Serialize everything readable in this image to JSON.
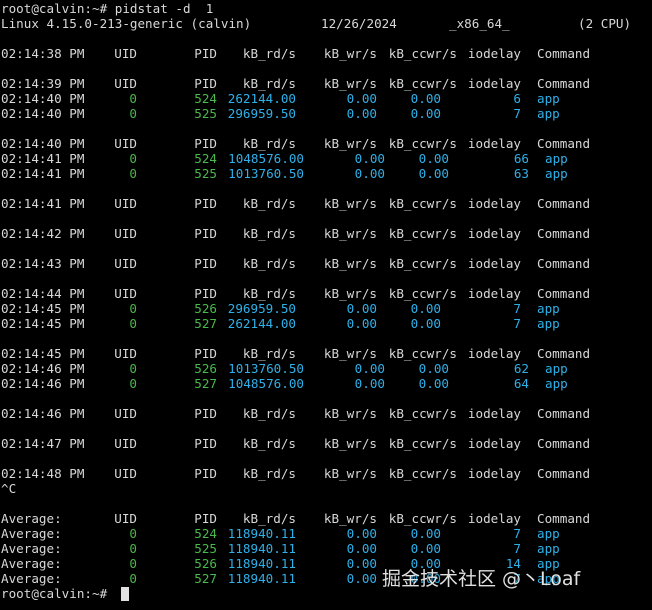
{
  "prompt_command": "root@calvin:~# pidstat -d  1",
  "sysinfo": {
    "kernel": "Linux 4.15.0-213-generic (calvin)",
    "date": "12/26/2024",
    "arch": "_x86_64_",
    "cpus": "(2 CPU)"
  },
  "lines": [
    {
      "kind": "header",
      "time": "02:14:38 PM"
    },
    {
      "kind": "blank"
    },
    {
      "kind": "header",
      "time": "02:14:39 PM"
    },
    {
      "kind": "row",
      "time": "02:14:40 PM",
      "uid": "0",
      "pid": "524",
      "rd": "262144.00",
      "wr": "0.00",
      "ccwr": "0.00",
      "iodelay": "6",
      "command": "app"
    },
    {
      "kind": "row",
      "time": "02:14:40 PM",
      "uid": "0",
      "pid": "525",
      "rd": "296959.50",
      "wr": "0.00",
      "ccwr": "0.00",
      "iodelay": "7",
      "command": "app"
    },
    {
      "kind": "blank"
    },
    {
      "kind": "header",
      "time": "02:14:40 PM"
    },
    {
      "kind": "row",
      "time": "02:14:41 PM",
      "uid": "0",
      "pid": "524",
      "rd": "1048576.00",
      "wr": "0.00",
      "ccwr": "0.00",
      "iodelay": "66",
      "command": "app"
    },
    {
      "kind": "row",
      "time": "02:14:41 PM",
      "uid": "0",
      "pid": "525",
      "rd": "1013760.50",
      "wr": "0.00",
      "ccwr": "0.00",
      "iodelay": "63",
      "command": "app"
    },
    {
      "kind": "blank"
    },
    {
      "kind": "header",
      "time": "02:14:41 PM"
    },
    {
      "kind": "blank"
    },
    {
      "kind": "header",
      "time": "02:14:42 PM"
    },
    {
      "kind": "blank"
    },
    {
      "kind": "header",
      "time": "02:14:43 PM"
    },
    {
      "kind": "blank"
    },
    {
      "kind": "header",
      "time": "02:14:44 PM"
    },
    {
      "kind": "row",
      "time": "02:14:45 PM",
      "uid": "0",
      "pid": "526",
      "rd": "296959.50",
      "wr": "0.00",
      "ccwr": "0.00",
      "iodelay": "7",
      "command": "app"
    },
    {
      "kind": "row",
      "time": "02:14:45 PM",
      "uid": "0",
      "pid": "527",
      "rd": "262144.00",
      "wr": "0.00",
      "ccwr": "0.00",
      "iodelay": "7",
      "command": "app"
    },
    {
      "kind": "blank"
    },
    {
      "kind": "header",
      "time": "02:14:45 PM"
    },
    {
      "kind": "row",
      "time": "02:14:46 PM",
      "uid": "0",
      "pid": "526",
      "rd": "1013760.50",
      "wr": "0.00",
      "ccwr": "0.00",
      "iodelay": "62",
      "command": "app"
    },
    {
      "kind": "row",
      "time": "02:14:46 PM",
      "uid": "0",
      "pid": "527",
      "rd": "1048576.00",
      "wr": "0.00",
      "ccwr": "0.00",
      "iodelay": "64",
      "command": "app"
    },
    {
      "kind": "blank"
    },
    {
      "kind": "header",
      "time": "02:14:46 PM"
    },
    {
      "kind": "blank"
    },
    {
      "kind": "header",
      "time": "02:14:47 PM"
    },
    {
      "kind": "blank"
    },
    {
      "kind": "header",
      "time": "02:14:48 PM"
    },
    {
      "kind": "text",
      "text": "^C"
    },
    {
      "kind": "blank"
    },
    {
      "kind": "header",
      "time": "Average:"
    },
    {
      "kind": "row",
      "time": "Average:",
      "uid": "0",
      "pid": "524",
      "rd": "118940.11",
      "wr": "0.00",
      "ccwr": "0.00",
      "iodelay": "7",
      "command": "app"
    },
    {
      "kind": "row",
      "time": "Average:",
      "uid": "0",
      "pid": "525",
      "rd": "118940.11",
      "wr": "0.00",
      "ccwr": "0.00",
      "iodelay": "7",
      "command": "app"
    },
    {
      "kind": "row",
      "time": "Average:",
      "uid": "0",
      "pid": "526",
      "rd": "118940.11",
      "wr": "0.00",
      "ccwr": "0.00",
      "iodelay": "14",
      "command": "app"
    },
    {
      "kind": "row",
      "time": "Average:",
      "uid": "0",
      "pid": "527",
      "rd": "118940.11",
      "wr": "0.00",
      "ccwr": "0.00",
      "iodelay": "7",
      "command": "app"
    },
    {
      "kind": "prompt",
      "text": "root@calvin:~# "
    }
  ],
  "columns": {
    "uid": "UID",
    "pid": "PID",
    "rd": "kB_rd/s",
    "wr": "kB_wr/s",
    "ccwr": "kB_ccwr/s",
    "iodelay": "iodelay",
    "command": "Command"
  },
  "watermark": "掘金技术社区 @丶Loaf",
  "colors": {
    "background": "#000000",
    "text": "#d8d8d8",
    "uid_pid": "#4ab84a",
    "values": "#2fb0e8"
  }
}
